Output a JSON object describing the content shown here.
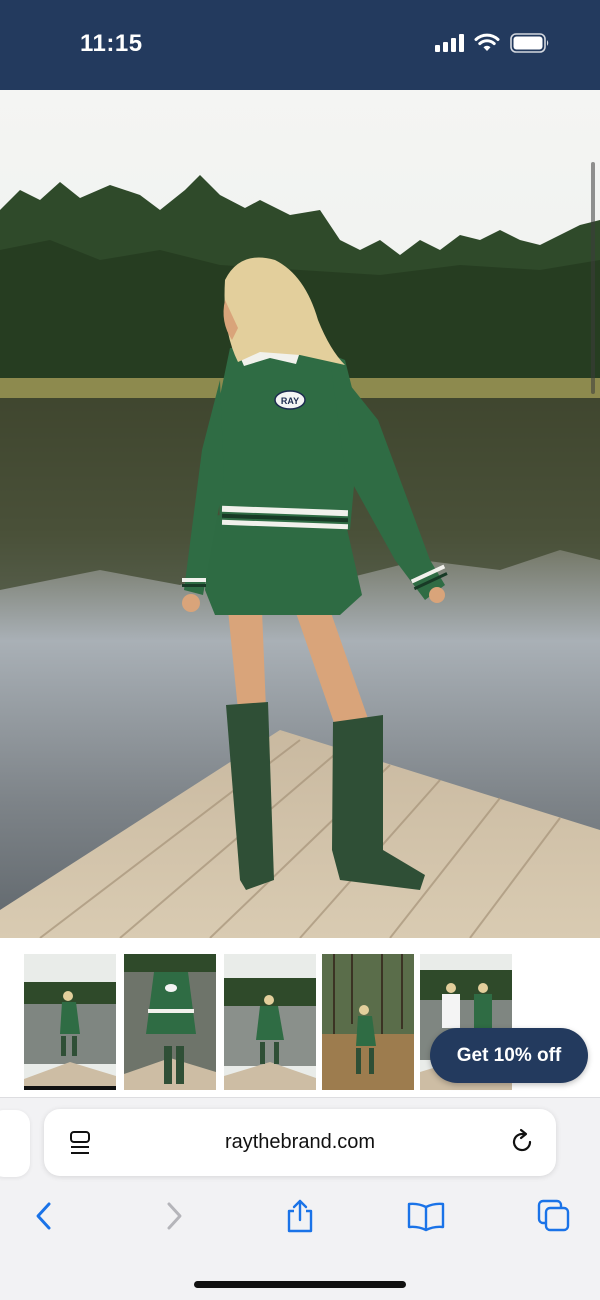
{
  "status_bar": {
    "time": "11:15",
    "icons": [
      "signal-icon",
      "wifi-icon",
      "battery-icon"
    ],
    "background": "#233a5e"
  },
  "product_gallery": {
    "main_image": "model in green RAY sweater and skirt with green rain boots on a lake dock",
    "thumbnails": [
      {
        "icon": "thumbnail-dock-full",
        "selected": true
      },
      {
        "icon": "thumbnail-closeup",
        "selected": false
      },
      {
        "icon": "thumbnail-dock-side",
        "selected": false
      },
      {
        "icon": "thumbnail-forest",
        "selected": false
      },
      {
        "icon": "thumbnail-two-models",
        "selected": false
      }
    ]
  },
  "promo": {
    "discount_label": "Get 10% off"
  },
  "browser": {
    "url": "raythebrand.com",
    "toolbar": [
      "back-icon",
      "forward-icon",
      "share-icon",
      "bookmarks-icon",
      "tabs-icon"
    ],
    "accent": "#1a73e8"
  }
}
